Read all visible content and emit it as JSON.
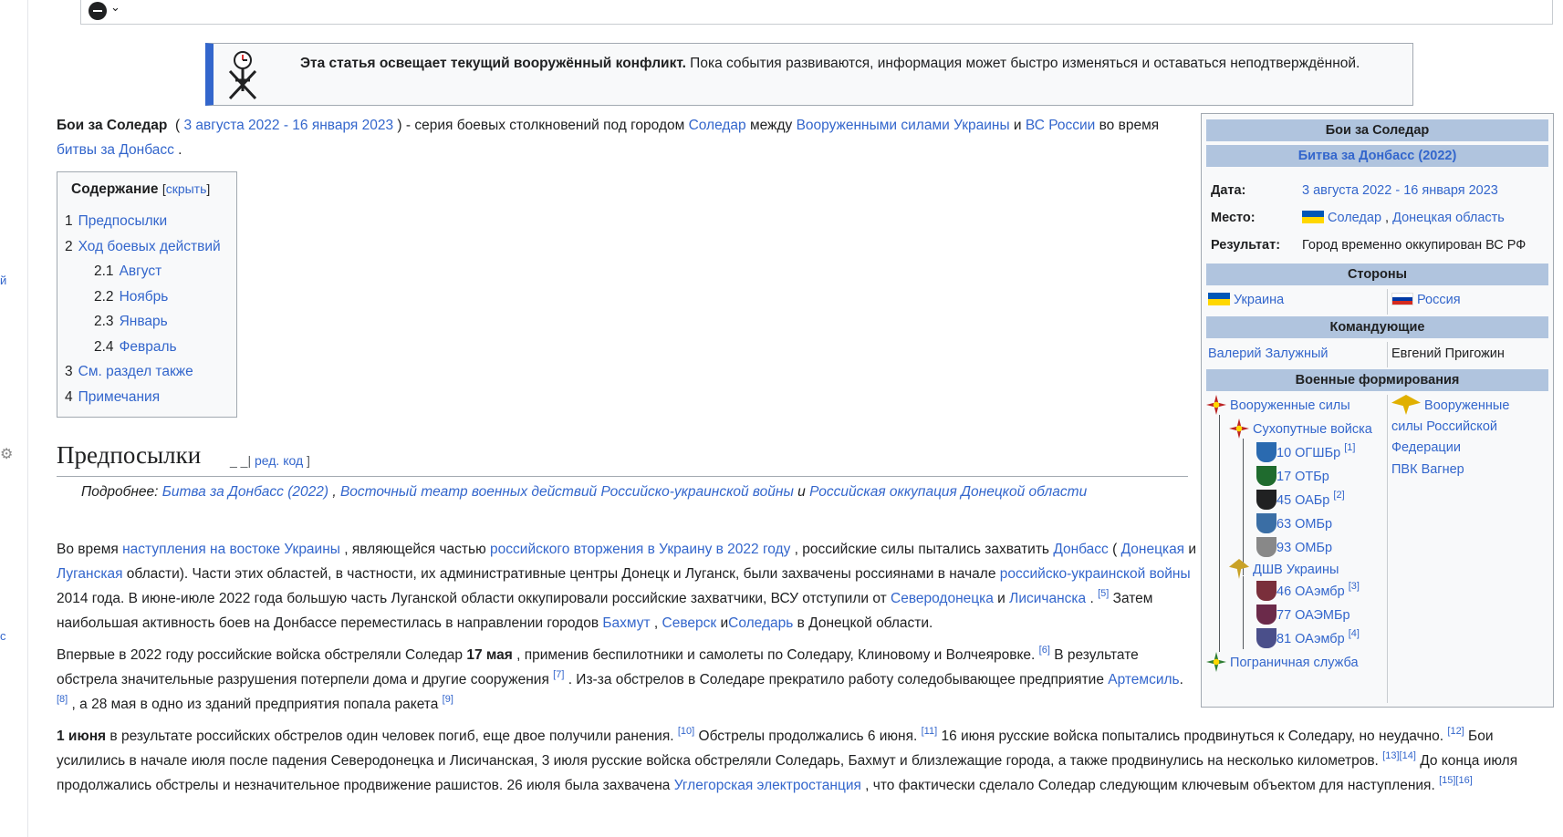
{
  "left_rail": {
    "mark_1": "й",
    "mark_2": "с"
  },
  "notice": {
    "bold": "Эта статья освещает текущий вооружённый конфликт.",
    "rest": " Пока события развиваются, информация может быстро изменяться и оставаться неподтверждённой."
  },
  "lead": {
    "title": "Бои за Соледар",
    "dates": "3 августа 2022 - 16 января 2023",
    "t1": " ) - серия боевых столкновений под городом ",
    "soledar": "Соледар",
    "t2": " между ",
    "afu": "Вооруженными силами Украины",
    "t3": " и ",
    "vs": "ВС России",
    "t4": " во время ",
    "donbas": "битвы за Донбасс",
    "t5": " ."
  },
  "toc": {
    "title": "Содержание",
    "hide": "скрыть",
    "items": [
      {
        "num": "1",
        "label": "Предпосылки",
        "sub": false
      },
      {
        "num": "2",
        "label": "Ход боевых действий",
        "sub": false
      },
      {
        "num": "2.1",
        "label": "Август",
        "sub": true
      },
      {
        "num": "2.2",
        "label": "Ноябрь",
        "sub": true
      },
      {
        "num": "2.3",
        "label": "Январь",
        "sub": true
      },
      {
        "num": "2.4",
        "label": "Февраль",
        "sub": true
      },
      {
        "num": "3",
        "label": "См. раздел также",
        "sub": false
      },
      {
        "num": "4",
        "label": "Примечания",
        "sub": false
      }
    ]
  },
  "section": {
    "title": "Предпосылки",
    "edit_pre": "_ _|",
    "edit": "ред. код",
    "edit_post": "]"
  },
  "hatnote": {
    "pre": "Подробнее: ",
    "l1": "Битва за Донбасс (2022)",
    "sep1": " , ",
    "l2": "Восточный театр военных действий Российско-украинской войны",
    "sep2": " и ",
    "l3": "Российская оккупация Донецкой области"
  },
  "para1": {
    "a": "Во время ",
    "l1": "наступления на востоке Украины",
    "b": " , являющейся частью ",
    "l2": "российского вторжения в Украину в 2022 году",
    "c": " , российские силы пытались захватить ",
    "l3": "Донбасс",
    "d": " ( ",
    "l4": "Донецкая",
    "e": " и ",
    "l5": "Луганская",
    "f": " области). Части этих областей, в частности, их административные центры Донецк и Луганск, были захвачены россиянами в начале ",
    "l6": "российско-украинской войны",
    "g": " 2014 года. В июне-июле 2022 года большую часть Луганской области оккупировали российские захватчики, ВСУ отступили от ",
    "l7": "Северодонецка",
    "h": " и ",
    "l8": "Лисичанска",
    "i": " . ",
    "r5": "[5]",
    "j": " Затем наибольшая активность боев на Донбассе переместилась в направлении городов ",
    "l9": "Бахмут",
    "k": " , ",
    "l10": "Северск",
    "l": " и",
    "l11": "Соледарь",
    "m": " в Донецкой области."
  },
  "para2": {
    "a": "Впервые в 2022 году российские войска обстреляли Соледар ",
    "b": "17 мая",
    "c": " , применив беспилотники и самолеты по Соледару, Клиновому и Волчеяровке. ",
    "r6": "[6]",
    "d": " В результате обстрела значительные разрушения потерпели дома и другие сооружения ",
    "r7": "[7]",
    "e": " . Из-за обстрелов в Соледаре прекратило работу соледобывающее предприятие ",
    "l1": "Артемсиль",
    "f": ". ",
    "r8": "[8]",
    "g": " , а 28 мая в одно из зданий предприятия попала ракета ",
    "r9": "[9]"
  },
  "para3": {
    "a": "1 июня",
    "b": " в результате российских обстрелов один человек погиб, еще двое получили ранения. ",
    "r10": "[10]",
    "c": " Обстрелы продолжались 6 июня. ",
    "r11": "[11]",
    "d": " 16 июня русские войска попытались продвинуться к Соледару, но неудачно. ",
    "r12": "[12]",
    "e": " Бои усилились в начале июля после падения Северодонецка и Лисичанская, 3 июля русские войска обстреляли Соледарь, Бахмут и близлежащие города, а также продвинулись на несколько километров. ",
    "r13": "[13]",
    "r14": "[14]",
    "f": " До конца июля продолжались обстрелы и незначительное продвижение рашистов. 26 июля была захвачена ",
    "l1": "Углегорская электростанция",
    "g": " , что фактически сделало Соледар следующим ключевым объектом для наступления. ",
    "r15": "[15]",
    "r16": "[16]"
  },
  "infobox": {
    "title": "Бои за Соледар",
    "subtitle": "Битва за Донбасс (2022)",
    "date_label": "Дата:",
    "date_value": "3 августа 2022 - 16 января 2023",
    "place_label": "Место:",
    "place_city": "Соледар",
    "place_sep": " , ",
    "place_region": "Донецкая область",
    "result_label": "Результат:",
    "result_value": "Город временно оккупирован ВС РФ",
    "sides_head": "Стороны",
    "side_ua": "Украина",
    "side_ru": "Россия",
    "commanders_head": "Командующие",
    "cmd_ua": "Валерий Залужный",
    "cmd_ru": "Евгений Пригожин",
    "units_head": "Военные формирования",
    "ua_units": {
      "armed_forces": "Вооруженные силы",
      "ground_forces": "Сухопутные войска",
      "u10": "10 ОГШБр",
      "r1": "[1]",
      "u17": "17 ОТБр",
      "u45": "45 ОАБр",
      "r2": "[2]",
      "u63": "63 ОМБр",
      "u93": "93 ОМБр",
      "dshv": "ДШВ Украины",
      "u46": "46 ОАэмбр",
      "r3": "[3]",
      "u77": "77 ОАЭМБр",
      "u81": "81 ОАэмбр",
      "r4": "[4]",
      "border": "Пограничная служба"
    },
    "ru_units": {
      "armed_forces": "Вооруженные силы Российской Федерации",
      "wagner": "ПВК Вагнер"
    }
  },
  "colors": {
    "link": "#3366cc",
    "infobox_header": "#b0c4de",
    "notice_bar": "#3366cc"
  }
}
